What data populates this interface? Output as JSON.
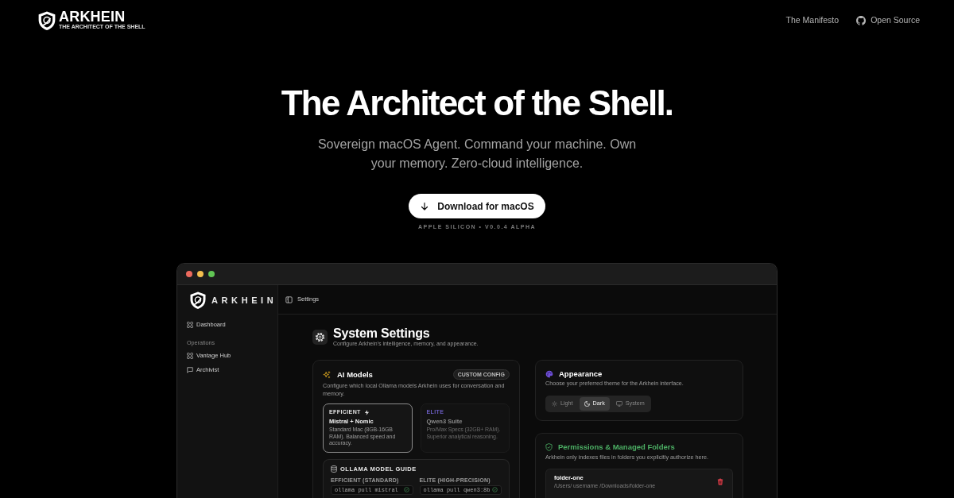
{
  "nav": {
    "brand": "ARKHEIN",
    "tagline": "THE ARCHITECT OF THE SHELL",
    "links": [
      {
        "kind": "plain",
        "label": "The Manifesto"
      },
      {
        "kind": "github",
        "label": "Open Source"
      }
    ]
  },
  "hero": {
    "title": "The Architect of the Shell.",
    "subtitle": "Sovereign macOS Agent. Command your machine. Own your memory. Zero-cloud intelligence.",
    "download_button": "Download for macOS",
    "caption": "APPLE SILICON • V0.0.4 ALPHA"
  },
  "app_window": {
    "sidebar": {
      "brand": "ARKHEIN",
      "items": [
        {
          "kind": "grid",
          "label": "Dashboard"
        },
        {
          "kind": "section",
          "label": "Operations"
        },
        {
          "kind": "grid",
          "label": "Vantage Hub"
        },
        {
          "kind": "chat",
          "label": "Archivist"
        }
      ]
    },
    "breadcrumb": "Settings",
    "header": {
      "title": "System Settings",
      "subtitle": "Configure Arkhein's intelligence, memory, and appearance."
    },
    "ai_models": {
      "title": "AI Models",
      "badge": "CUSTOM CONFIG",
      "description": "Configure which local Ollama models Arkhein uses for conversation and memory.",
      "options": [
        {
          "tier": "EFFICIENT",
          "color": "#e0e0e0",
          "bolt": true,
          "name": "Mistral + Nomic",
          "description": "Standard Mac (8GB-16GB RAM). Balanced speed and accuracy.",
          "selected": true
        },
        {
          "tier": "ELITE",
          "color": "#6a5cc0",
          "bolt": false,
          "name": "Qwen3 Suite",
          "description": "Pro/Max Specs (32GB+ RAM). Superior analytical reasoning.",
          "selected": false
        }
      ],
      "guide": {
        "title": "OLLAMA MODEL GUIDE",
        "columns": [
          {
            "label": "EFFICIENT (STANDARD)",
            "command": "ollama pull mistral"
          },
          {
            "label": "ELITE (HIGH-PRECISION)",
            "command": "ollama pull qwen3:8b"
          }
        ]
      }
    },
    "appearance": {
      "title": "Appearance",
      "description": "Choose your preferred theme for the Arkhein interface.",
      "themes": [
        {
          "kind": "light",
          "label": "Light",
          "selected": false
        },
        {
          "kind": "dark",
          "label": "Dark",
          "selected": true
        },
        {
          "kind": "system",
          "label": "System",
          "selected": false
        }
      ]
    },
    "permissions": {
      "title": "Permissions & Managed Folders",
      "description": "Arkhein only indexes files in folders you explicitly authorize here.",
      "folders": [
        {
          "name": "folder-one",
          "path": "/Users/ username /Downloads/folder-one"
        }
      ]
    }
  }
}
